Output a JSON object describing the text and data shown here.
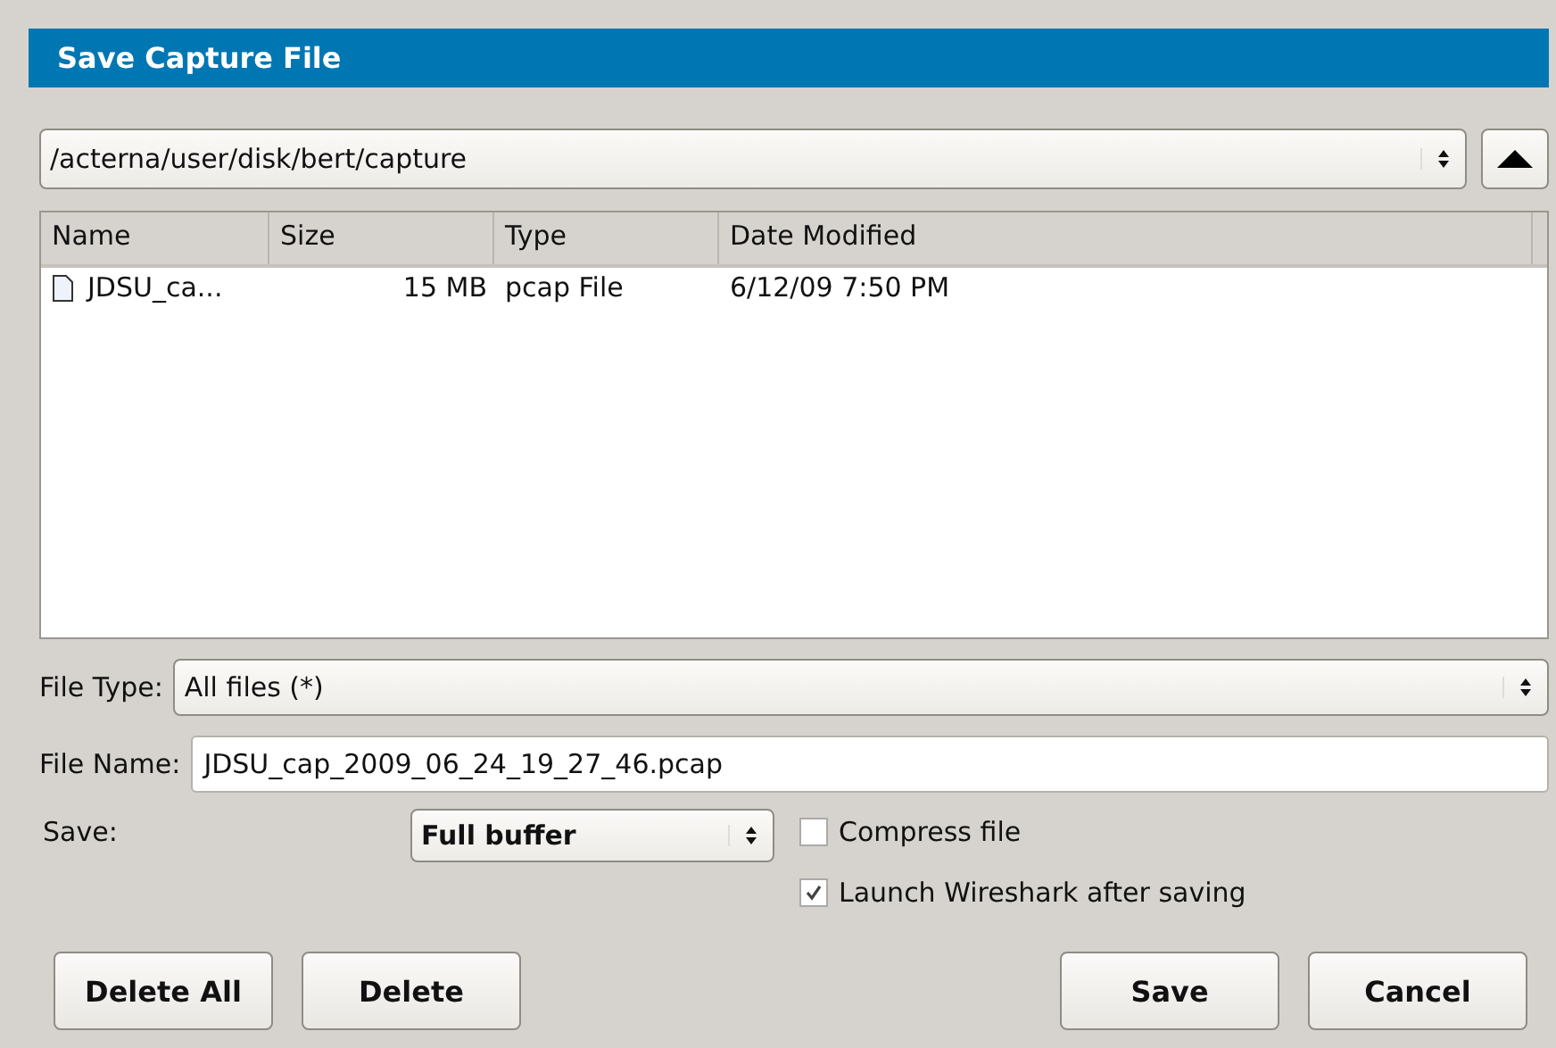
{
  "window": {
    "title": "Save Capture File"
  },
  "path": {
    "value": "/acterna/user/disk/bert/capture"
  },
  "table": {
    "columns": [
      "Name",
      "Size",
      "Type",
      "Date Modified"
    ],
    "rows": [
      {
        "name": "JDSU_ca...",
        "size": "15 MB",
        "type": "pcap File",
        "date": "6/12/09 7:50 PM"
      }
    ]
  },
  "file_type": {
    "label": "File Type:",
    "value": "All files (*)"
  },
  "file_name": {
    "label": "File Name:",
    "value": "JDSU_cap_2009_06_24_19_27_46.pcap"
  },
  "save": {
    "label": "Save:",
    "value": "Full buffer"
  },
  "options": [
    {
      "label": "Compress file",
      "checked": false
    },
    {
      "label": "Launch Wireshark after saving",
      "checked": true
    }
  ],
  "buttons_left": [
    "Delete All",
    "Delete"
  ],
  "buttons_right": [
    "Save",
    "Cancel"
  ]
}
